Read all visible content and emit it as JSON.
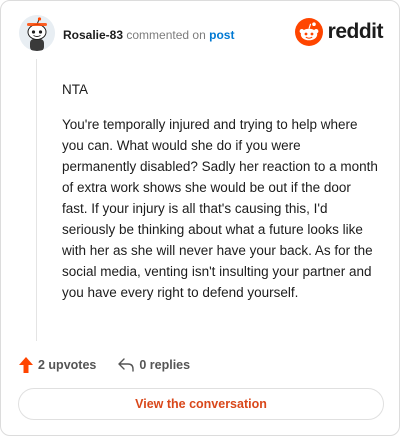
{
  "header": {
    "author": "Rosalie-83",
    "commented_on": "commented on",
    "post_link": "post",
    "brand": "reddit"
  },
  "comment": {
    "paragraphs": [
      "NTA",
      "You're temporally injured and trying to help where you can. What would she do if you were permanently disabled? Sadly her reaction to a month of extra work shows she would be out if the door fast. If your injury is all that's causing this, I'd seriously be thinking about what a future looks like with her as she will never have your back. As for the social media, venting isn't insulting your partner and you have every right to defend yourself."
    ]
  },
  "actions": {
    "upvotes_label": "2 upvotes",
    "replies_label": "0 replies"
  },
  "view_conversation_label": "View the conversation",
  "colors": {
    "brand": "#ff4500",
    "upvote": "#ff4500",
    "link": "#0079d3",
    "cta": "#d9471a"
  },
  "icons": {
    "avatar": "snoo-avatar",
    "brand": "reddit-logo-icon",
    "upvote": "upvote-arrow-icon",
    "reply": "reply-arrow-icon"
  }
}
